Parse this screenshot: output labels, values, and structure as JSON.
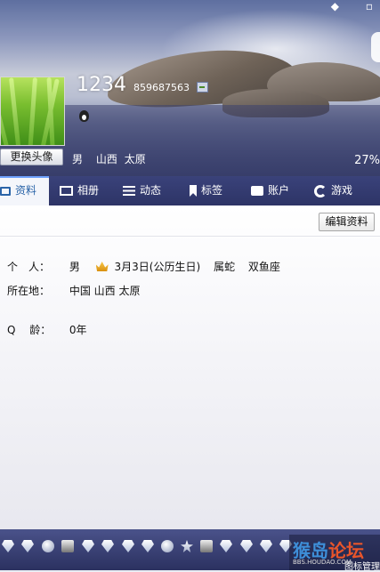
{
  "header": {
    "nickname": "1234",
    "qq_number": "859687563",
    "change_avatar_label": "更换头像",
    "gender": "男",
    "province": "山西",
    "city": "太原",
    "completion": "27%",
    "top_glyphs": [
      "◆",
      "▫"
    ]
  },
  "tabs": [
    {
      "label": "资料",
      "icon": "profile-card-icon",
      "active": true
    },
    {
      "label": "相册",
      "icon": "photo-album-icon",
      "active": false
    },
    {
      "label": "动态",
      "icon": "feed-list-icon",
      "active": false
    },
    {
      "label": "标签",
      "icon": "bookmark-tag-icon",
      "active": false
    },
    {
      "label": "账户",
      "icon": "briefcase-icon",
      "active": false
    },
    {
      "label": "游戏",
      "icon": "game-icon",
      "active": false
    }
  ],
  "content": {
    "edit_profile_label": "编辑资料",
    "personal": {
      "label": "个　人：",
      "gender": "男",
      "birthday": "3月3日(公历生日)",
      "zodiac": "属蛇",
      "constellation": "双鱼座"
    },
    "location": {
      "label": "所在地：",
      "value": "中国 山西 太原"
    },
    "qq_age": {
      "label": "Q　 龄：",
      "value": "0年"
    }
  },
  "footer": {
    "badges": [
      "diamond-badge",
      "diamond-badge",
      "penguin-badge",
      "monitor-badge",
      "diamond-badge",
      "diamond-badge",
      "diamond-badge",
      "diamond-badge",
      "round-badge",
      "square-badge",
      "star-badge",
      "music-badge",
      "diamond-badge",
      "diamond-badge",
      "diamond-badge",
      "diamond-badge"
    ],
    "watermark_main_a": "猴岛",
    "watermark_main_b": "论坛",
    "watermark_sub": "BBS.HOUDAO.COM",
    "watermark_side": "图标管理"
  },
  "colors": {
    "tab_bar": "#2d3466",
    "active_tab_text": "#2a64a8",
    "header_overlay": "#343a66"
  }
}
